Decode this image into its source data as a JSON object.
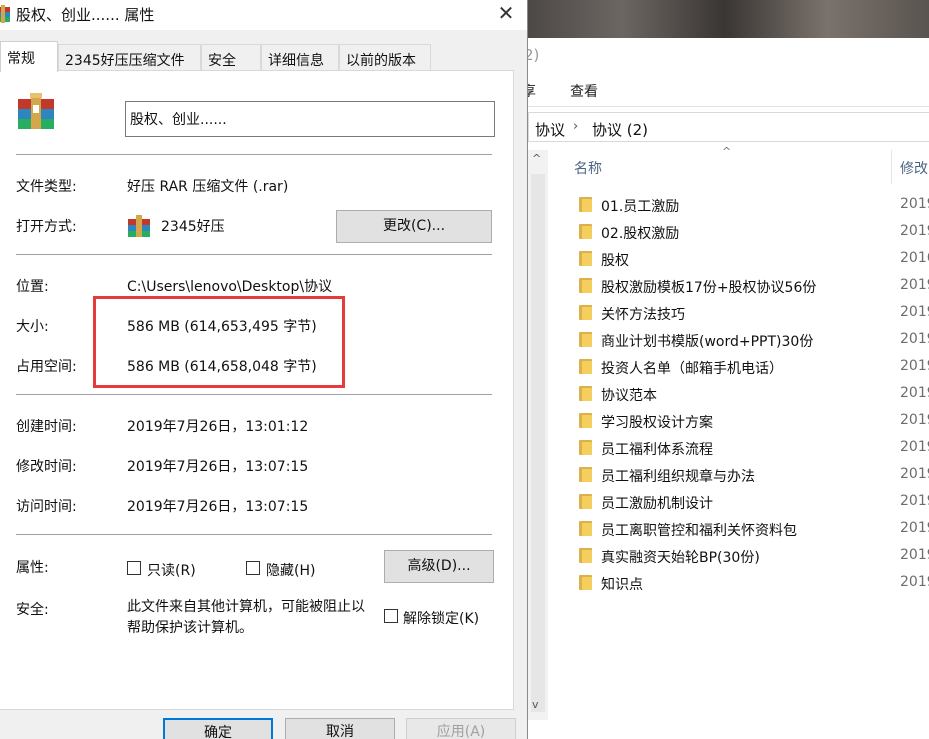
{
  "dialog": {
    "title": "股权、创业...... 属性",
    "tabs": [
      "常规",
      "2345好压压缩文件",
      "安全",
      "详细信息",
      "以前的版本"
    ],
    "filename": "股权、创业......",
    "file_type_label": "文件类型:",
    "file_type_value": "好压 RAR 压缩文件 (.rar)",
    "open_with_label": "打开方式:",
    "open_with_value": "2345好压",
    "change_button": "更改(C)...",
    "location_label": "位置:",
    "location_value": "C:\\Users\\lenovo\\Desktop\\协议",
    "size_label": "大小:",
    "size_value": "586 MB (614,653,495 字节)",
    "size_on_disk_label": "占用空间:",
    "size_on_disk_value": "586 MB (614,658,048 字节)",
    "created_label": "创建时间:",
    "created_value": "2019年7月26日，13:01:12",
    "modified_label": "修改时间:",
    "modified_value": "2019年7月26日，13:07:15",
    "accessed_label": "访问时间:",
    "accessed_value": "2019年7月26日，13:07:15",
    "attributes_label": "属性:",
    "readonly_label": "只读(R)",
    "hidden_label": "隐藏(H)",
    "advanced_button": "高级(D)...",
    "security_label": "安全:",
    "security_text": "此文件来自其他计算机，可能被阻止以帮助保护该计算机。",
    "unblock_label": "解除锁定(K)",
    "ok_button": "确定",
    "cancel_button": "取消",
    "apply_button": "应用(A)",
    "close_glyph": "✕"
  },
  "explorer": {
    "title_fragment": "2)",
    "ribbon_fragment": "享",
    "view_tab": "查看",
    "breadcrumb": [
      "协议",
      "协议 (2)"
    ],
    "breadcrumb_sep": "›",
    "column_name": "名称",
    "column_modified": "修改",
    "sort_caret": "^",
    "scroll_up": "^",
    "scroll_down": "v",
    "files": [
      {
        "name": "01.员工激励",
        "date": "2019"
      },
      {
        "name": "02.股权激励",
        "date": "2019"
      },
      {
        "name": "股权",
        "date": "2016"
      },
      {
        "name": "股权激励模板17份+股权协议56份",
        "date": "2019"
      },
      {
        "name": "关怀方法技巧",
        "date": "2019"
      },
      {
        "name": "商业计划书模版(word+PPT)30份",
        "date": "2019"
      },
      {
        "name": "投资人名单（邮箱手机电话）",
        "date": "2019"
      },
      {
        "name": "协议范本",
        "date": "2019"
      },
      {
        "name": "学习股权设计方案",
        "date": "2019"
      },
      {
        "name": "员工福利体系流程",
        "date": "2019"
      },
      {
        "name": "员工福利组织规章与办法",
        "date": "2019"
      },
      {
        "name": "员工激励机制设计",
        "date": "2019"
      },
      {
        "name": "员工离职管控和福利关怀资料包",
        "date": "2019"
      },
      {
        "name": "真实融资天始轮BP(30份)",
        "date": "2019"
      },
      {
        "name": "知识点",
        "date": "2019"
      }
    ]
  },
  "colors": {
    "highlight_box": "#e53b3b",
    "folder_yellow": "#f4cf5d",
    "header_text": "#4d6584",
    "primary_border": "#0078d7"
  }
}
